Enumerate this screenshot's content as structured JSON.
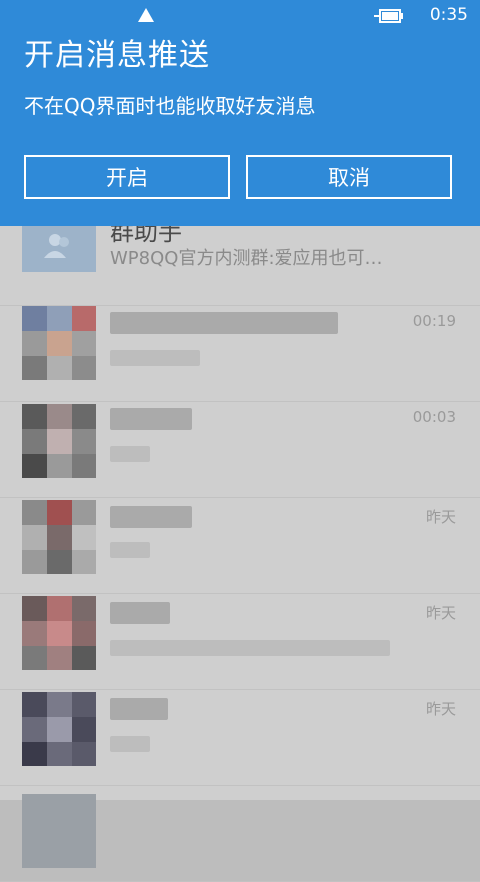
{
  "status_bar": {
    "clock": "0:35",
    "signal_icon": "signal-icon",
    "battery_icon": "battery-charging-icon"
  },
  "dialog": {
    "title": "开启消息推送",
    "message": "不在QQ界面时也能收取好友消息",
    "confirm_label": "开启",
    "cancel_label": "取消",
    "accent_color": "#2f8ad8"
  },
  "chat_list": {
    "items": [
      {
        "name": "群助手",
        "preview": "WP8QQ官方内测群:爱应用也可…",
        "time": ""
      },
      {
        "name": "",
        "preview": "",
        "time": "00:19"
      },
      {
        "name": "",
        "preview": "",
        "time": "00:03"
      },
      {
        "name": "",
        "preview": "",
        "time": "昨天"
      },
      {
        "name": "",
        "preview": "",
        "time": "昨天"
      },
      {
        "name": "",
        "preview": "",
        "time": "昨天"
      }
    ]
  }
}
